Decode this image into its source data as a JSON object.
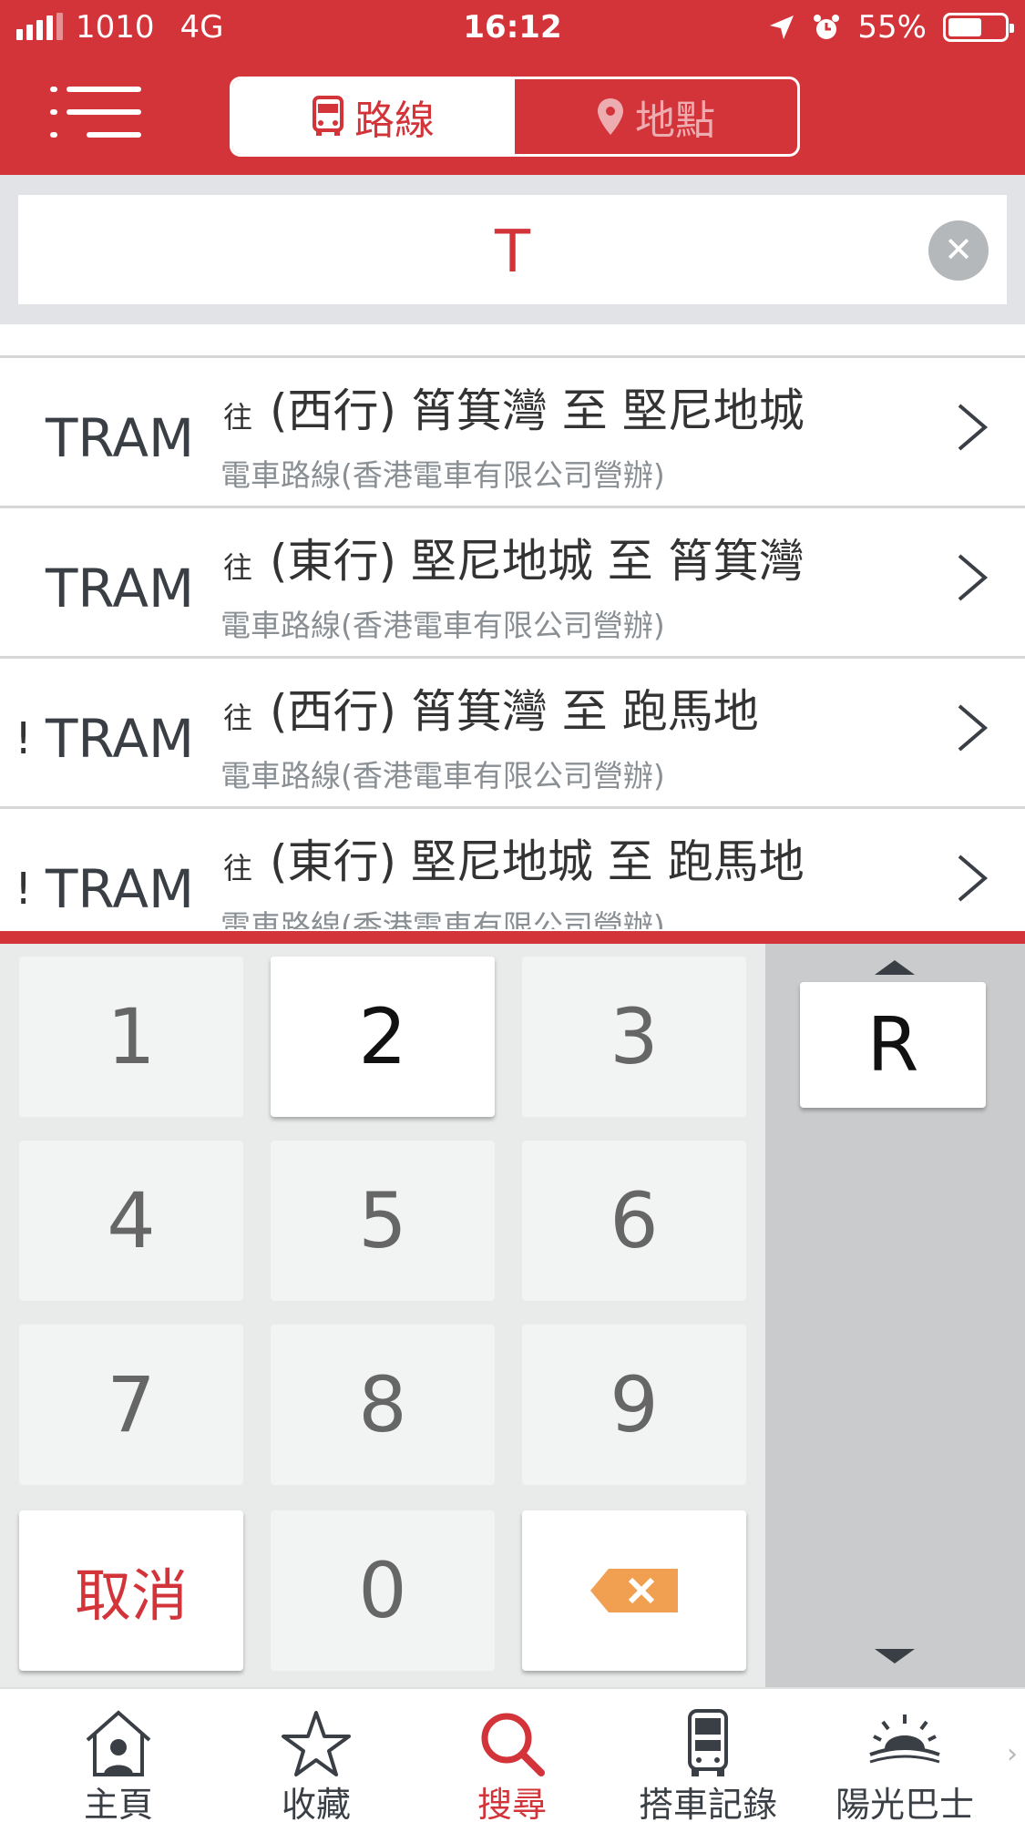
{
  "status_bar": {
    "carrier": "1010",
    "network": "4G",
    "time": "16:12",
    "battery": "55%"
  },
  "header": {
    "segments": [
      {
        "label": "路線",
        "icon": "bus-icon",
        "active": true
      },
      {
        "label": "地點",
        "icon": "location-pin-icon",
        "active": false
      }
    ]
  },
  "search": {
    "query": "T"
  },
  "routes": [
    {
      "alert": "",
      "code": "TRAM",
      "prefix": "往",
      "destination": "(西行) 筲箕灣 至 堅尼地城",
      "operator": "電車路線(香港電車有限公司營辦)"
    },
    {
      "alert": "",
      "code": "TRAM",
      "prefix": "往",
      "destination": "(東行) 堅尼地城 至 筲箕灣",
      "operator": "電車路線(香港電車有限公司營辦)"
    },
    {
      "alert": "!",
      "code": "TRAM",
      "prefix": "往",
      "destination": "(西行) 筲箕灣 至 跑馬地",
      "operator": "電車路線(香港電車有限公司營辦)"
    },
    {
      "alert": "!",
      "code": "TRAM",
      "prefix": "往",
      "destination": "(東行) 堅尼地城 至 跑馬地",
      "operator": "電車路線(香港電車有限公司營辦)"
    }
  ],
  "keypad": {
    "keys": [
      "1",
      "2",
      "3",
      "4",
      "5",
      "6",
      "7",
      "8",
      "9",
      "取消",
      "0"
    ],
    "cancel_label": "取消",
    "letters": [
      "R"
    ]
  },
  "tabbar": {
    "tabs": [
      {
        "label": "主頁",
        "icon": "home-icon"
      },
      {
        "label": "收藏",
        "icon": "star-icon"
      },
      {
        "label": "搜尋",
        "icon": "search-icon"
      },
      {
        "label": "搭車記錄",
        "icon": "bus-history-icon"
      },
      {
        "label": "陽光巴士",
        "icon": "sunshine-bus-icon"
      }
    ],
    "more": "›"
  },
  "colors": {
    "brand_red": "#d3343a",
    "delete_orange": "#f0a050"
  }
}
